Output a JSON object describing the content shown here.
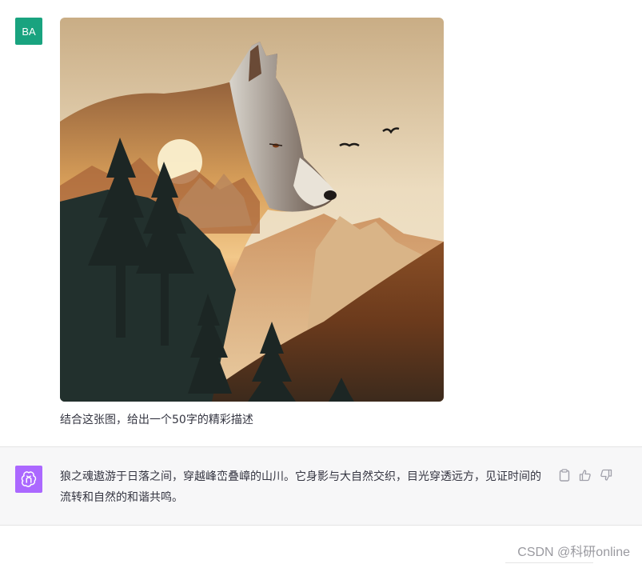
{
  "user_message": {
    "avatar_text": "BA",
    "avatar_color": "#19a37f",
    "text": "结合这张图，给出一个50字的精彩描述"
  },
  "assistant_message": {
    "avatar_icon": "openai-logo-icon",
    "avatar_color": "#ab68ff",
    "text": "狼之魂遨游于日落之间，穿越峰峦叠嶂的山川。它身影与大自然交织，目光穿透远方，见证时间的流转和自然的和谐共鸣。",
    "actions": [
      {
        "icon": "clipboard-icon"
      },
      {
        "icon": "thumbs-up-icon"
      },
      {
        "icon": "thumbs-down-icon"
      }
    ]
  },
  "watermark": "CSDN @科研online"
}
